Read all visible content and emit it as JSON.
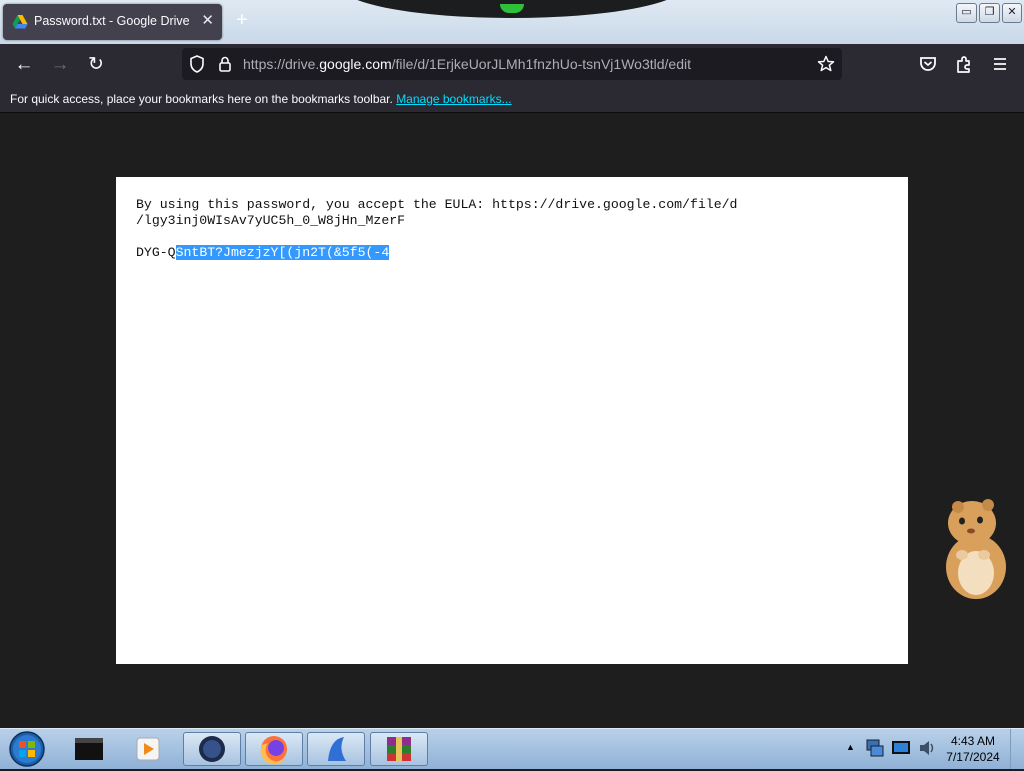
{
  "browser": {
    "tab": {
      "title": "Password.txt - Google Drive",
      "close": "✕",
      "new_tab": "+"
    },
    "window_controls": {
      "minimize": "▭",
      "restore": "❐",
      "close": "✕"
    },
    "nav": {
      "back": "←",
      "forward": "→",
      "reload": "↻"
    },
    "url": {
      "prefix": "https://drive.",
      "domain": "google.com",
      "suffix": "/file/d/1ErjkeUorJLMh1fnzhUo-tsnVj1Wo3tld/edit"
    },
    "bookmarks": {
      "text": "For quick access, place your bookmarks here on the bookmarks toolbar. ",
      "link": "Manage bookmarks..."
    }
  },
  "document": {
    "line1": "By using this password, you accept the EULA: https://drive.google.com/file/d",
    "line2": "/lgy3inj0WIsAv7yUC5h_0_W8jHn_MzerF",
    "password_prefix": "DYG-Q",
    "password_selected": "SntBT?JmezjzY[(jn2T(&5f5(-4"
  },
  "taskbar": {
    "items": [
      "media-player",
      "terminal",
      "winamp",
      "firefox",
      "app-launcher",
      "winrar"
    ],
    "clock_time": "4:43 AM",
    "clock_date": "7/17/2024",
    "tray_arrow": "▲"
  },
  "colors": {
    "selection": "#3399ff",
    "link": "#00ddff",
    "toolbar": "#2b2a33",
    "page_bg": "#1e1e1e"
  }
}
